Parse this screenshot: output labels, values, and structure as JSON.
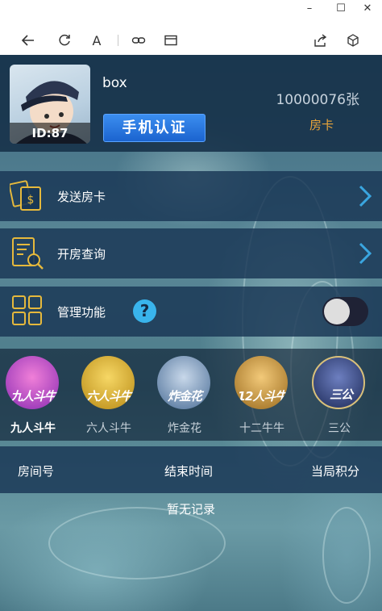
{
  "window": {
    "minimize_glyph": "–",
    "maximize_glyph": "☐",
    "close_glyph": "✕"
  },
  "toolbar": {
    "font_glyph": "A",
    "icons": [
      "back-arrow-icon",
      "refresh-icon",
      "font-size-icon",
      "link-icon",
      "card-icon",
      "share-icon",
      "cube-icon"
    ]
  },
  "profile": {
    "id_text": "ID:87",
    "username": "box",
    "verify_button": "手机认证",
    "card_count": "10000076张",
    "card_label": "房卡"
  },
  "menu": {
    "send_card": "发送房卡",
    "room_query": "开房查询",
    "manage": "管理功能",
    "help_glyph": "?",
    "manage_toggle_on": false
  },
  "games": [
    {
      "title": "九人斗牛",
      "label": "九人斗牛",
      "active": true
    },
    {
      "title": "六人斗牛",
      "label": "六人斗牛",
      "active": false
    },
    {
      "title": "炸金花",
      "label": "炸金花",
      "active": false
    },
    {
      "title": "12人斗牛",
      "label": "十二牛牛",
      "active": false
    },
    {
      "title": "三公",
      "label": "三公",
      "active": false
    }
  ],
  "table": {
    "headers": [
      "房间号",
      "结束时间",
      "当局积分"
    ],
    "empty_text": "暂无记录"
  },
  "colors": {
    "accent_gold": "#e8a43a",
    "button_blue": "#1b63cf",
    "help_blue": "#39b4ec",
    "chevron_blue": "#3aa6e0"
  }
}
